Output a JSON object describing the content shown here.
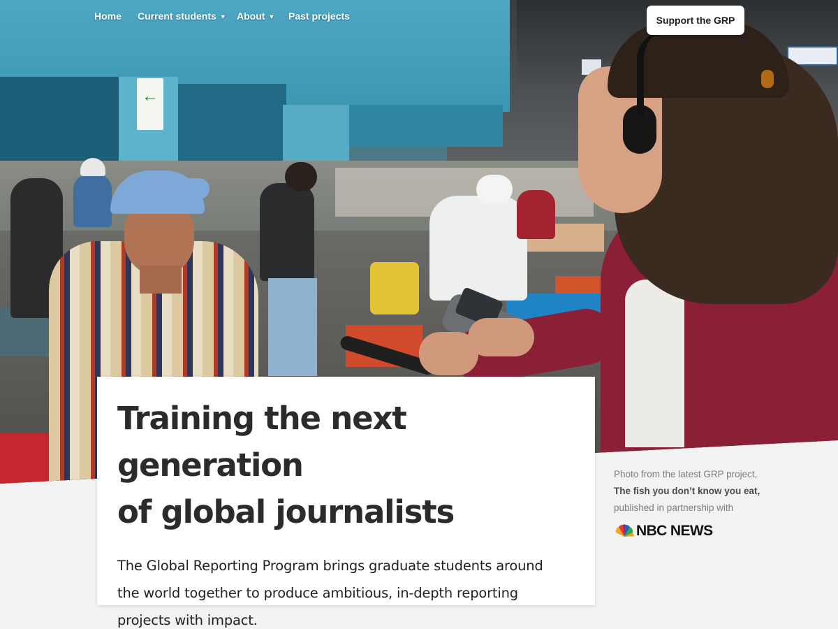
{
  "nav": {
    "items": [
      {
        "label": "Home"
      },
      {
        "label": "Current students",
        "dropdown": true
      },
      {
        "label": "About",
        "dropdown": true
      },
      {
        "label": "Past projects"
      }
    ],
    "support_button": "Support the GRP"
  },
  "hero": {
    "headline_line1": "Training the next generation",
    "headline_line2": "of global journalists",
    "description": "The Global Reporting Program brings graduate students around the world together to produce ambitious, in-depth reporting projects  with impact."
  },
  "caption": {
    "line1": "Photo from the latest GRP project,",
    "project_title": "The fish you don’t know you eat,",
    "line3": "published in partnership with",
    "partner_logo_text": "NBC NEWS"
  },
  "icons": {
    "dropdown": "chevron-down-icon",
    "partner": "nbc-peacock-icon"
  },
  "colors": {
    "background": "#f2f2f2",
    "card": "#ffffff",
    "headline": "#2b2b2b"
  }
}
